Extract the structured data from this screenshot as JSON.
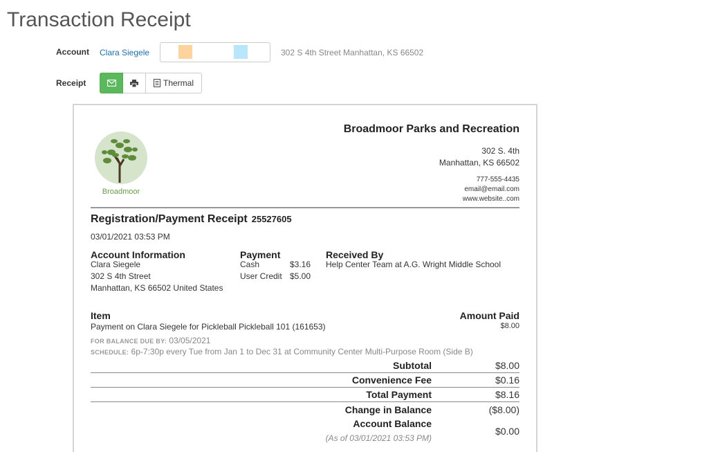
{
  "page": {
    "title": "Transaction Receipt"
  },
  "account": {
    "label": "Account",
    "name": "Clara Siegele",
    "address": "302 S 4th Street Manhattan, KS 66502",
    "flag_colors": [
      "#ffd39e",
      "#b9e6fb"
    ]
  },
  "receipt_bar": {
    "label": "Receipt",
    "thermal_label": "Thermal",
    "email_icon": "envelope-icon",
    "print_icon": "printer-icon",
    "thermal_icon": "receipt-doc-icon",
    "accent_color": "#5cb85c"
  },
  "org": {
    "name": "Broadmoor Parks and Recreation",
    "address_line1": "302 S. 4th",
    "address_line2": "Manhattan, KS 66502",
    "phone": "777-555-4435",
    "email": "email@email.com",
    "website": "www.website..com",
    "logo_text": "Broadmoor"
  },
  "receipt": {
    "heading": "Registration/Payment Receipt",
    "number": "25527605",
    "date": "03/01/2021 03:53 PM",
    "account_info": {
      "heading": "Account Information",
      "name": "Clara Siegele",
      "street": "302 S 4th Street",
      "city": "Manhattan, KS 66502 United States"
    },
    "payment": {
      "heading": "Payment",
      "rows": [
        {
          "method": "Cash",
          "amount": "$3.16"
        },
        {
          "method": "User Credit",
          "amount": "$5.00"
        }
      ]
    },
    "received_by": {
      "heading": "Received By",
      "value": "Help Center Team at A.G. Wright Middle School"
    },
    "items": {
      "item_header": "Item",
      "amount_header": "Amount Paid",
      "description": "Payment on Clara Siegele for Pickleball Pickleball 101 (161653)",
      "amount": "$8.00",
      "balance_due_label": "FOR BALANCE DUE BY:",
      "balance_due_date": "03/05/2021",
      "schedule_label": "SCHEDULE:",
      "schedule_value": "6p-7:30p every Tue from Jan 1 to Dec 31 at Community Center Multi-Purpose Room (Side B)"
    },
    "totals": [
      {
        "label": "Subtotal",
        "value": "$8.00"
      },
      {
        "label": "Convenience Fee",
        "value": "$0.16"
      },
      {
        "label": "Total Payment",
        "value": "$8.16"
      },
      {
        "label": "Change in Balance",
        "value": "($8.00)"
      }
    ],
    "account_balance": {
      "label": "Account Balance",
      "as_of": "(As of 03/01/2021 03:53 PM)",
      "value": "$0.00"
    }
  }
}
